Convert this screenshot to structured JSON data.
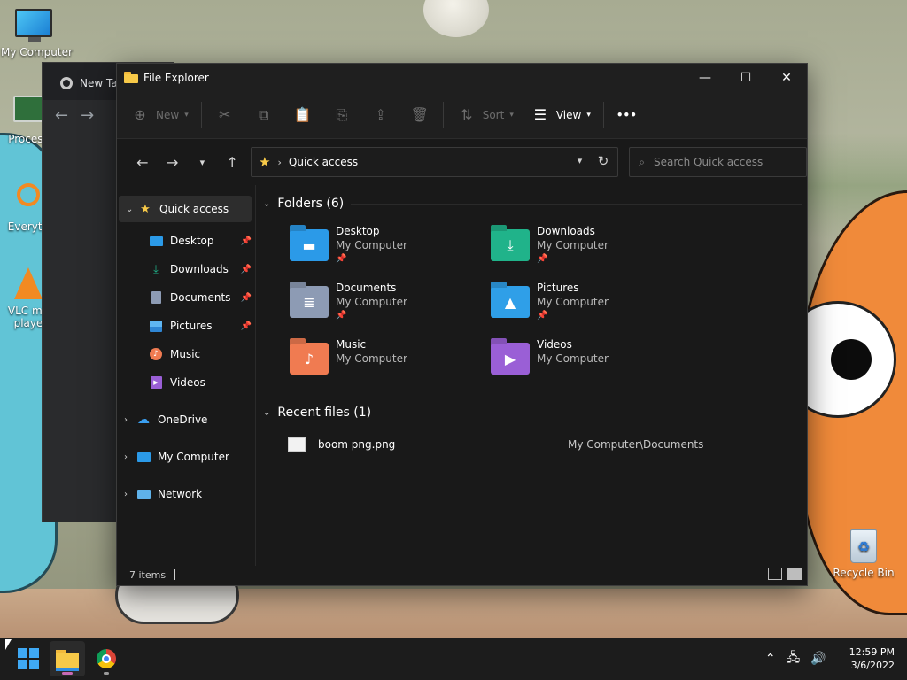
{
  "desktop": {
    "icons": [
      {
        "label": "My Computer"
      },
      {
        "label": "Process"
      },
      {
        "label": "Everyth"
      },
      {
        "label": "VLC me"
      },
      {
        "label": "playe"
      },
      {
        "label": "Recycle Bin"
      }
    ]
  },
  "chrome_window": {
    "tab_label": "New Ta"
  },
  "explorer": {
    "title": "File Explorer",
    "window_controls": {
      "minimize": "—",
      "maximize": "☐",
      "close": "✕"
    },
    "commandbar": {
      "new_label": "New",
      "sort_label": "Sort",
      "view_label": "View",
      "more_label": "•••"
    },
    "address": {
      "path": "Quick access",
      "search_placeholder": "Search Quick access"
    },
    "nav": {
      "quick_access": "Quick access",
      "items": [
        {
          "label": "Desktop",
          "pinned": true
        },
        {
          "label": "Downloads",
          "pinned": true
        },
        {
          "label": "Documents",
          "pinned": true
        },
        {
          "label": "Pictures",
          "pinned": true
        },
        {
          "label": "Music",
          "pinned": false
        },
        {
          "label": "Videos",
          "pinned": false
        }
      ],
      "onedrive": "OneDrive",
      "my_computer": "My Computer",
      "network": "Network"
    },
    "folders_header": "Folders (6)",
    "folders": [
      {
        "name": "Desktop",
        "location": "My Computer",
        "pinned": true,
        "color": "#2b9ae8"
      },
      {
        "name": "Downloads",
        "location": "My Computer",
        "pinned": true,
        "color": "#20b38a"
      },
      {
        "name": "Documents",
        "location": "My Computer",
        "pinned": true,
        "color": "#8d9bb4"
      },
      {
        "name": "Pictures",
        "location": "My Computer",
        "pinned": true,
        "color": "#2f9fe8"
      },
      {
        "name": "Music",
        "location": "My Computer",
        "pinned": false,
        "color": "#f07b51"
      },
      {
        "name": "Videos",
        "location": "My Computer",
        "pinned": false,
        "color": "#9a5fd6"
      }
    ],
    "recent_header": "Recent files (1)",
    "recent_files": [
      {
        "name": "boom png.png",
        "location": "My Computer\\Documents"
      }
    ],
    "status": {
      "items": "7 items"
    }
  },
  "taskbar": {
    "time": "12:59 PM",
    "date": "3/6/2022"
  }
}
